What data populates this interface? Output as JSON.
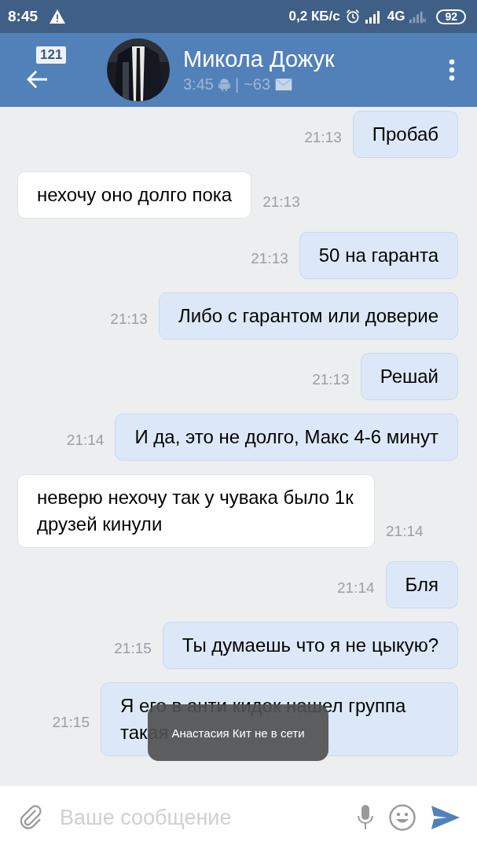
{
  "status_bar": {
    "time": "8:45",
    "speed": "0,2 КБ/с",
    "network": "4G",
    "battery": "92"
  },
  "header": {
    "unread_badge": "121",
    "name": "Микола Дожук",
    "last_seen": "3:45",
    "separator": "|",
    "count": "~63"
  },
  "messages": [
    {
      "text": "Пробаб",
      "time": "21:13",
      "outgoing": true
    },
    {
      "text": "нехочу оно долго пока",
      "time": "21:13",
      "outgoing": false
    },
    {
      "text": "50 на гаранта",
      "time": "21:13",
      "outgoing": true
    },
    {
      "text": "Либо с гарантом или доверие",
      "time": "21:13",
      "outgoing": true
    },
    {
      "text": "Решай",
      "time": "21:13",
      "outgoing": true
    },
    {
      "text": "И да, это не долго, Макс 4-6 минут",
      "time": "21:14",
      "outgoing": true
    },
    {
      "text": "неверю нехочу так у чувака было 1к друзей кинули",
      "time": "21:14",
      "outgoing": false
    },
    {
      "text": "Бля",
      "time": "21:14",
      "outgoing": true
    },
    {
      "text": "Ты думаешь что я не цыкую?",
      "time": "21:15",
      "outgoing": true
    },
    {
      "text": "Я его в анти кидок нашел группа такая",
      "time": "21:15",
      "outgoing": true
    }
  ],
  "toast": "Анастасия Кит не в сети",
  "composer": {
    "placeholder": "Ваше сообщение"
  }
}
